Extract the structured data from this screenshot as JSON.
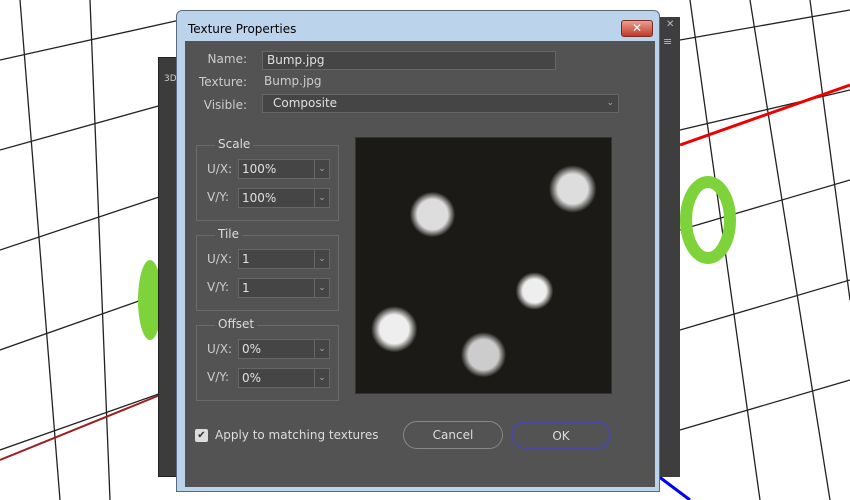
{
  "background_panel": {
    "label": "3D"
  },
  "dialog": {
    "title": "Texture Properties",
    "close_label": "✕",
    "name_label": "Name:",
    "name_value": "Bump.jpg",
    "texture_label": "Texture:",
    "texture_value": "Bump.jpg",
    "visible_label": "Visible:",
    "visible_value": "Composite",
    "scale": {
      "title": "Scale",
      "ux_label": "U/X:",
      "ux_value": "100%",
      "vy_label": "V/Y:",
      "vy_value": "100%"
    },
    "tile": {
      "title": "Tile",
      "ux_label": "U/X:",
      "ux_value": "1",
      "vy_label": "V/Y:",
      "vy_value": "1"
    },
    "offset": {
      "title": "Offset",
      "ux_label": "U/X:",
      "ux_value": "0%",
      "vy_label": "V/Y:",
      "vy_value": "0%"
    },
    "apply_label": "Apply to matching textures",
    "apply_checked": true,
    "cancel_label": "Cancel",
    "ok_label": "OK"
  }
}
